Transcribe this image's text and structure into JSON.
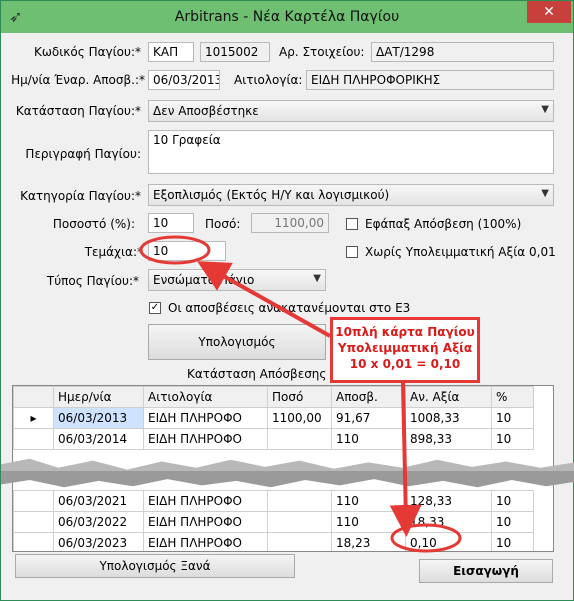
{
  "window": {
    "title": "Arbitrans - Νέα Καρτέλα Παγίου",
    "close_glyph": "✕",
    "app_icon": "bird-icon"
  },
  "form": {
    "code_label": "Κωδικός Παγίου:*",
    "code_prefix": "ΚΑΠ",
    "code_number": "1015002",
    "doc_no_label": "Αρ. Στοιχείου:",
    "doc_no": "ΔΑΤ/1298",
    "start_date_label": "Ημ/νία Έναρ. Αποσβ.:*",
    "start_date": "06/03/2013",
    "reason_label": "Αιτιολογία:",
    "reason": "ΕΙΔΗ ΠΛΗΡΟΦΟΡΙΚΗΣ",
    "status_label": "Κατάσταση Παγίου:*",
    "status": "Δεν Αποσβέστηκε",
    "description_label": "Περιγραφή Παγίου:",
    "description": "10 Γραφεία",
    "category_label": "Κατηγορία Παγίου:*",
    "category": "Εξοπλισμός (Εκτός Η/Υ και λογισμικού)",
    "percent_label": "Ποσοστό (%):",
    "percent": "10",
    "amount_label": "Ποσό:",
    "amount": "1100,00",
    "one_time_label": "Εφάπαξ Απόσβεση (100%)",
    "pieces_label": "Τεμάχια:*",
    "pieces": "10",
    "no_residual_label": "Χωρίς Υπολειμματική Αξία 0,01",
    "type_label": "Τύπος Παγίου:*",
    "type": "Ενσώματο Πάγιο",
    "e3_label": "Οι αποσβέσεις ανακατανέμονται στο Ε3",
    "e3_checked": true,
    "calc_button": "Υπολογισμός"
  },
  "grid": {
    "caption": "Κατάσταση Απόσβεσης",
    "columns": [
      "Ημερ/νία",
      "Αιτιολογία",
      "Ποσό",
      "Αποσβ.",
      "Αν. Αξία",
      "%"
    ],
    "rows": [
      {
        "date": "06/03/2013",
        "reason": "ΕΙΔΗ ΠΛΗΡΟΦΟ",
        "amount": "1100,00",
        "depr": "91,67",
        "value": "1008,33",
        "pct": "10"
      },
      {
        "date": "06/03/2014",
        "reason": "ΕΙΔΗ ΠΛΗΡΟΦΟ",
        "amount": "",
        "depr": "110",
        "value": "898,33",
        "pct": "10"
      },
      {
        "date": "06/03/2021",
        "reason": "ΕΙΔΗ ΠΛΗΡΟΦΟ",
        "amount": "",
        "depr": "110",
        "value": "128,33",
        "pct": "10"
      },
      {
        "date": "06/03/2022",
        "reason": "ΕΙΔΗ ΠΛΗΡΟΦΟ",
        "amount": "",
        "depr": "110",
        "value": "18,33",
        "pct": "10"
      },
      {
        "date": "06/03/2023",
        "reason": "ΕΙΔΗ ΠΛΗΡΟΦΟ",
        "amount": "",
        "depr": "18,23",
        "value": "0,10",
        "pct": "10"
      }
    ]
  },
  "footer": {
    "recalc_button": "Υπολογισμός Ξανά",
    "insert_button": "Εισαγωγή"
  },
  "annotation": {
    "line1": "10πλή κάρτα Παγίου",
    "line2": "Υπολειμματική Αξία",
    "line3": "10 x 0,01 = 0,10",
    "color": "#e53935"
  }
}
